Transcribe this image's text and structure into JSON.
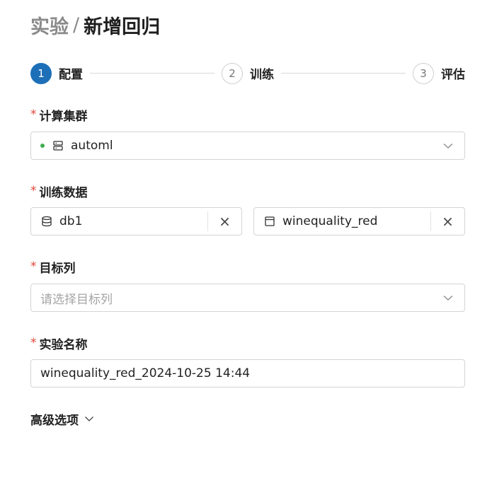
{
  "breadcrumb": {
    "parent": "实验",
    "separator": "/",
    "current": "新增回归"
  },
  "steps": [
    {
      "number": "1",
      "label": "配置",
      "active": true
    },
    {
      "number": "2",
      "label": "训练",
      "active": false
    },
    {
      "number": "3",
      "label": "评估",
      "active": false
    }
  ],
  "form": {
    "required_mark": "*",
    "cluster": {
      "label": "计算集群",
      "value": "automl",
      "status_color": "#3fae4f",
      "icon": "server-icon"
    },
    "training_data": {
      "label": "训练数据",
      "database": {
        "value": "db1",
        "icon": "database-icon"
      },
      "table": {
        "value": "winequality_red",
        "icon": "table-icon"
      },
      "clear_symbol": "×"
    },
    "target_column": {
      "label": "目标列",
      "placeholder": "请选择目标列"
    },
    "experiment_name": {
      "label": "实验名称",
      "value": "winequality_red_2024-10-25 14:44"
    }
  },
  "advanced": {
    "label": "高级选项"
  },
  "colors": {
    "accent": "#1d6fb8",
    "required": "#e0453a"
  }
}
